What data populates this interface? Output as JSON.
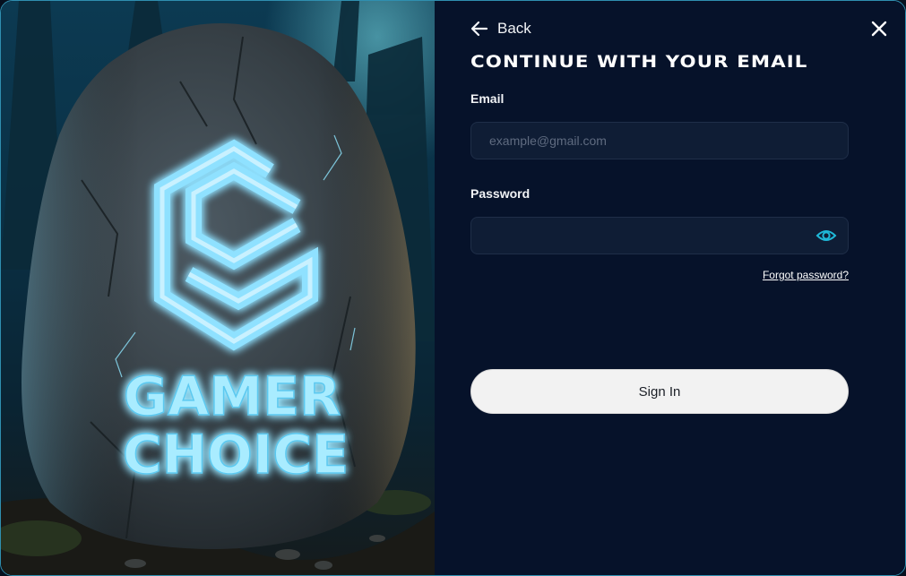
{
  "art": {
    "logo_line1": "GAMER",
    "logo_line2": "CHOICE",
    "glow_color": "#7fdcff"
  },
  "nav": {
    "back_label": "Back"
  },
  "form": {
    "heading": "CONTINUE WITH YOUR EMAIL",
    "email_label": "Email",
    "email_placeholder": "example@gmail.com",
    "email_value": "",
    "password_label": "Password",
    "password_value": "",
    "forgot_label": "Forgot password?",
    "signin_label": "Sign In"
  },
  "colors": {
    "accent": "#1fb8d8",
    "panel_bg": "#06122a",
    "input_bg": "#0f1d35",
    "button_bg": "#f2f2f2"
  },
  "icons": {
    "back": "arrow-left-icon",
    "close": "close-icon",
    "password_toggle": "eye-icon"
  }
}
